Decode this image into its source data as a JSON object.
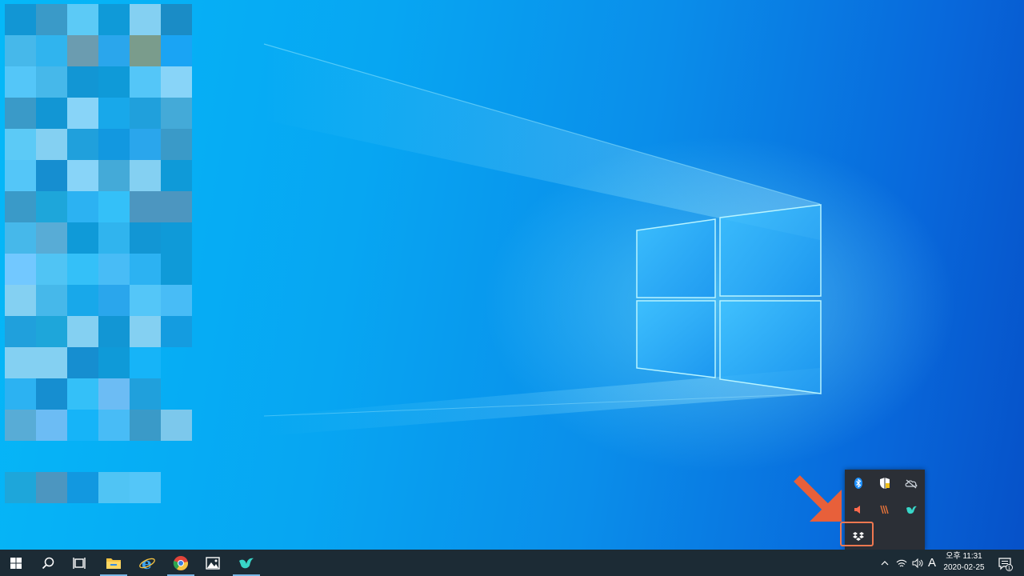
{
  "desktop": {
    "wallpaper": "windows-10-hero-wallpaper"
  },
  "tray_overflow": {
    "icons": [
      {
        "name": "bluetooth-icon",
        "color": "#1e90ff"
      },
      {
        "name": "security-shield-icon",
        "color": "#ffffff"
      },
      {
        "name": "onedrive-cloud-icon",
        "color": "#cfd6de"
      },
      {
        "name": "speaker-muted-icon",
        "color": "#ff6a4d"
      },
      {
        "name": "app-stripes-icon",
        "color": "#e8743a"
      },
      {
        "name": "bird-app-icon",
        "color": "#38d6c8"
      },
      {
        "name": "dropbox-icon",
        "color": "#ffffff"
      }
    ],
    "highlight_color": "#f07850",
    "arrow_color": "#e8603a"
  },
  "taskbar": {
    "background": "#1c2b35",
    "apps": [
      {
        "name": "start-button"
      },
      {
        "name": "search-button"
      },
      {
        "name": "task-view-button"
      },
      {
        "name": "file-explorer-button"
      },
      {
        "name": "internet-explorer-button"
      },
      {
        "name": "chrome-button"
      },
      {
        "name": "photos-button"
      },
      {
        "name": "bird-app-button"
      }
    ],
    "ime_label": "A",
    "clock": {
      "time": "오후 11:31",
      "date": "2020-02-25"
    },
    "notifications_count": "1"
  }
}
